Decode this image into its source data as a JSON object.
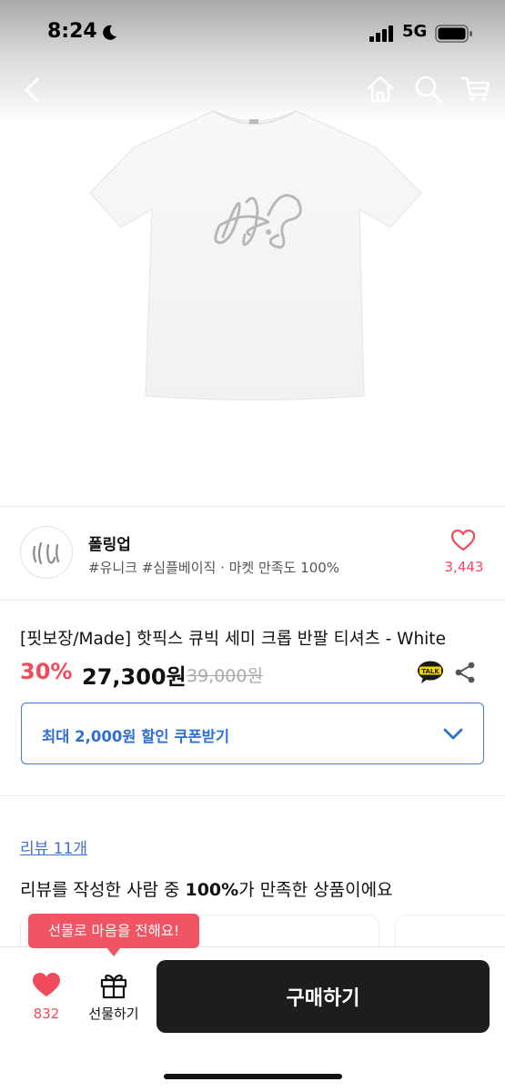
{
  "status_bar": {
    "time": "8:24",
    "network": "5G"
  },
  "nav": {
    "icons": [
      "back-icon",
      "home-icon",
      "search-icon",
      "cart-icon"
    ]
  },
  "product_image": {
    "print_text": "H.P"
  },
  "seller": {
    "name": "폴링업",
    "tags": "#유니크 #심플베이직 · 마켓 만족도 100%",
    "likes": "3,443"
  },
  "product": {
    "title": "[핏보장/Made] 핫픽스 큐빅 세미 크롭 반팔 티셔츠 - White",
    "discount": "30%",
    "price": "27,300원",
    "original_price": "39,000원"
  },
  "coupon": {
    "label": "최대 2,000원 할인 쿠폰받기"
  },
  "reviews": {
    "link": "리뷰 11개",
    "summary_prefix": "리뷰를 작성한 사람 중 ",
    "summary_bold": "100%",
    "summary_suffix": "가 만족한 상품이에요"
  },
  "bottom_bar": {
    "tooltip": "선물로 마음을 전해요!",
    "wish_count": "832",
    "gift_label": "선물하기",
    "buy_label": "구매하기"
  },
  "colors": {
    "accent": "#ef4b5a",
    "coupon_blue": "#2f6fd0",
    "buy_button": "#1d1d1f"
  }
}
